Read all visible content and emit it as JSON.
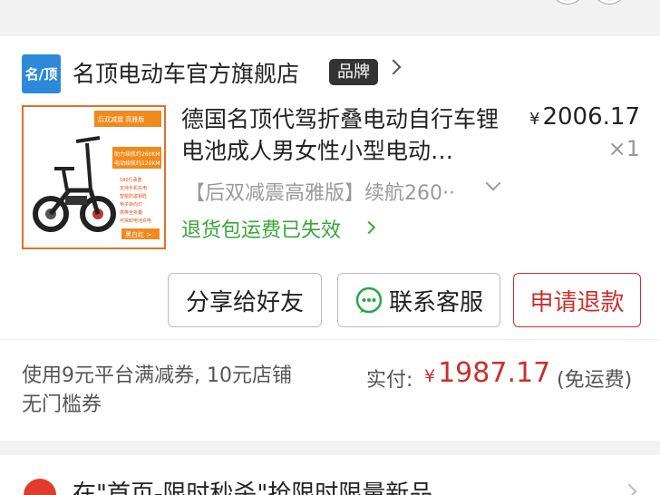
{
  "store": {
    "logo_text": "名/顶",
    "name": "名顶电动车官方旗舰店",
    "badge": "品牌"
  },
  "product": {
    "title": "德国名顶代驾折叠电动自行车锂电池成人男女性小型电动…",
    "price_symbol": "¥",
    "price": "2006.17",
    "quantity": "×1",
    "variant": "【后双减震高雅版】续航260··",
    "return_note": "退货包运费已失效",
    "image_text": {
      "tag": "后双减震 高雅版",
      "range1": "助力续航约260KM",
      "range2": "电动续航约120KM",
      "feature1": "180斤承重",
      "feature2": "支持手机充电",
      "feature3": "智能防盗钥匙",
      "feature4": "电子转向灯",
      "feature5": "携带全折叠",
      "feature6": "可拆卸电池充电",
      "color_label": "黑白红 >"
    }
  },
  "actions": {
    "share": "分享给好友",
    "contact": "联系客服",
    "refund": "申请退款"
  },
  "payment": {
    "coupon_text": "使用9元平台满减券, 10元店铺无门槛券",
    "paid_label": "实付:",
    "paid_symbol": "¥",
    "paid_amount": "1987.17",
    "shipping": "(免运费)"
  },
  "promo": {
    "icon_text": "秒",
    "text": "在\"首页-限时秒杀\"抢限时限量新品"
  },
  "colors": {
    "accent_red": "#c9302c",
    "green": "#3aa53a",
    "logo_blue": "#2e8ad8"
  }
}
